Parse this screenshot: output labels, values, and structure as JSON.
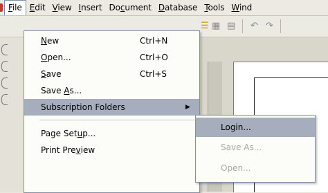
{
  "menubar": {
    "items": [
      {
        "label": "File",
        "accel": "F",
        "rest": "ile",
        "active": true
      },
      {
        "label": "Edit",
        "accel": "E",
        "rest": "dit"
      },
      {
        "label": "View",
        "accel": "V",
        "rest": "iew"
      },
      {
        "label": "Insert",
        "accel": "I",
        "rest": "nsert"
      },
      {
        "label": "Document",
        "pre": "Do",
        "accel": "c",
        "rest": "ument"
      },
      {
        "label": "Database",
        "accel": "D",
        "rest": "atabase"
      },
      {
        "label": "Tools",
        "accel": "T",
        "rest": "ools"
      },
      {
        "label": "Wind",
        "accel": "W",
        "rest": "ind"
      }
    ]
  },
  "file_menu": {
    "items": [
      {
        "pre": "",
        "accel": "N",
        "rest": "ew",
        "shortcut": "Ctrl+N"
      },
      {
        "pre": "",
        "accel": "O",
        "rest": "pen...",
        "shortcut": "Ctrl+O"
      },
      {
        "pre": "",
        "accel": "S",
        "rest": "ave",
        "shortcut": "Ctrl+S"
      },
      {
        "pre": "Save ",
        "accel": "A",
        "rest": "s...",
        "shortcut": ""
      },
      {
        "pre": "Subscription Folders",
        "accel": "",
        "rest": "",
        "shortcut": "",
        "submenu": true
      },
      {
        "pre": "Page Set",
        "accel": "u",
        "rest": "p...",
        "shortcut": ""
      },
      {
        "pre": "Print Pre",
        "accel": "v",
        "rest": "iew",
        "shortcut": ""
      }
    ]
  },
  "submenu": {
    "items": [
      {
        "label": "Login...",
        "enabled": true
      },
      {
        "label": "Save As...",
        "enabled": false
      },
      {
        "label": "Open...",
        "enabled": false
      }
    ]
  },
  "toolbar": {
    "icons": [
      "list-icon",
      "table-icon",
      "list-settings-icon",
      "undo-icon",
      "redo-icon"
    ]
  },
  "colors": {
    "highlight": "#a6aebe",
    "menu_bg": "#fcfcf9",
    "menu_border": "#7f8fa9",
    "disabled_text": "#a7a7a2"
  }
}
